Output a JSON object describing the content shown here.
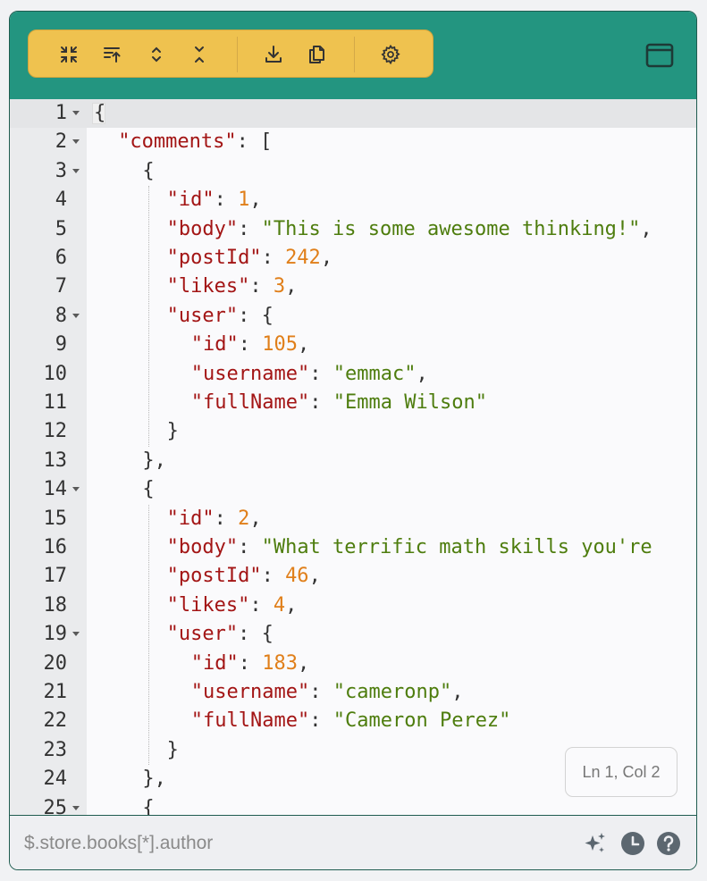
{
  "toolbar": {
    "buttons": [
      {
        "name": "collapse-all-button",
        "icon": "collapse-icon"
      },
      {
        "name": "sort-button",
        "icon": "sort-icon"
      },
      {
        "name": "expand-button",
        "icon": "expand-icon"
      },
      {
        "name": "collapse-button",
        "icon": "collapse-vertical-icon"
      },
      {
        "name": "download-button",
        "icon": "download-icon"
      },
      {
        "name": "copy-button",
        "icon": "copy-icon"
      },
      {
        "name": "settings-button",
        "icon": "gear-icon"
      }
    ],
    "window_button_icon": "window-icon"
  },
  "editor": {
    "active_line": 1,
    "lines": [
      {
        "n": "1",
        "fold": true,
        "indent": 0,
        "tokens": [
          [
            "p",
            "{"
          ]
        ]
      },
      {
        "n": "2",
        "fold": true,
        "indent": 1,
        "tokens": [
          [
            "k",
            "\"comments\""
          ],
          [
            "p",
            ": ["
          ]
        ]
      },
      {
        "n": "3",
        "fold": true,
        "indent": 2,
        "tokens": [
          [
            "p",
            "{"
          ]
        ]
      },
      {
        "n": "4",
        "fold": false,
        "indent": 3,
        "tokens": [
          [
            "k",
            "\"id\""
          ],
          [
            "p",
            ": "
          ],
          [
            "n",
            "1"
          ],
          [
            "p",
            ","
          ]
        ]
      },
      {
        "n": "5",
        "fold": false,
        "indent": 3,
        "tokens": [
          [
            "k",
            "\"body\""
          ],
          [
            "p",
            ": "
          ],
          [
            "s",
            "\"This is some awesome thinking!\""
          ],
          [
            "p",
            ","
          ]
        ]
      },
      {
        "n": "6",
        "fold": false,
        "indent": 3,
        "tokens": [
          [
            "k",
            "\"postId\""
          ],
          [
            "p",
            ": "
          ],
          [
            "n",
            "242"
          ],
          [
            "p",
            ","
          ]
        ]
      },
      {
        "n": "7",
        "fold": false,
        "indent": 3,
        "tokens": [
          [
            "k",
            "\"likes\""
          ],
          [
            "p",
            ": "
          ],
          [
            "n",
            "3"
          ],
          [
            "p",
            ","
          ]
        ]
      },
      {
        "n": "8",
        "fold": true,
        "indent": 3,
        "tokens": [
          [
            "k",
            "\"user\""
          ],
          [
            "p",
            ": {"
          ]
        ]
      },
      {
        "n": "9",
        "fold": false,
        "indent": 4,
        "tokens": [
          [
            "k",
            "\"id\""
          ],
          [
            "p",
            ": "
          ],
          [
            "n",
            "105"
          ],
          [
            "p",
            ","
          ]
        ]
      },
      {
        "n": "10",
        "fold": false,
        "indent": 4,
        "tokens": [
          [
            "k",
            "\"username\""
          ],
          [
            "p",
            ": "
          ],
          [
            "s",
            "\"emmac\""
          ],
          [
            "p",
            ","
          ]
        ]
      },
      {
        "n": "11",
        "fold": false,
        "indent": 4,
        "tokens": [
          [
            "k",
            "\"fullName\""
          ],
          [
            "p",
            ": "
          ],
          [
            "s",
            "\"Emma Wilson\""
          ]
        ]
      },
      {
        "n": "12",
        "fold": false,
        "indent": 3,
        "tokens": [
          [
            "p",
            "}"
          ]
        ]
      },
      {
        "n": "13",
        "fold": false,
        "indent": 2,
        "tokens": [
          [
            "p",
            "},"
          ]
        ]
      },
      {
        "n": "14",
        "fold": true,
        "indent": 2,
        "tokens": [
          [
            "p",
            "{"
          ]
        ]
      },
      {
        "n": "15",
        "fold": false,
        "indent": 3,
        "tokens": [
          [
            "k",
            "\"id\""
          ],
          [
            "p",
            ": "
          ],
          [
            "n",
            "2"
          ],
          [
            "p",
            ","
          ]
        ]
      },
      {
        "n": "16",
        "fold": false,
        "indent": 3,
        "tokens": [
          [
            "k",
            "\"body\""
          ],
          [
            "p",
            ": "
          ],
          [
            "s",
            "\"What terrific math skills you're"
          ]
        ]
      },
      {
        "n": "17",
        "fold": false,
        "indent": 3,
        "tokens": [
          [
            "k",
            "\"postId\""
          ],
          [
            "p",
            ": "
          ],
          [
            "n",
            "46"
          ],
          [
            "p",
            ","
          ]
        ]
      },
      {
        "n": "18",
        "fold": false,
        "indent": 3,
        "tokens": [
          [
            "k",
            "\"likes\""
          ],
          [
            "p",
            ": "
          ],
          [
            "n",
            "4"
          ],
          [
            "p",
            ","
          ]
        ]
      },
      {
        "n": "19",
        "fold": true,
        "indent": 3,
        "tokens": [
          [
            "k",
            "\"user\""
          ],
          [
            "p",
            ": {"
          ]
        ]
      },
      {
        "n": "20",
        "fold": false,
        "indent": 4,
        "tokens": [
          [
            "k",
            "\"id\""
          ],
          [
            "p",
            ": "
          ],
          [
            "n",
            "183"
          ],
          [
            "p",
            ","
          ]
        ]
      },
      {
        "n": "21",
        "fold": false,
        "indent": 4,
        "tokens": [
          [
            "k",
            "\"username\""
          ],
          [
            "p",
            ": "
          ],
          [
            "s",
            "\"cameronp\""
          ],
          [
            "p",
            ","
          ]
        ]
      },
      {
        "n": "22",
        "fold": false,
        "indent": 4,
        "tokens": [
          [
            "k",
            "\"fullName\""
          ],
          [
            "p",
            ": "
          ],
          [
            "s",
            "\"Cameron Perez\""
          ]
        ]
      },
      {
        "n": "23",
        "fold": false,
        "indent": 3,
        "tokens": [
          [
            "p",
            "}"
          ]
        ]
      },
      {
        "n": "24",
        "fold": false,
        "indent": 2,
        "tokens": [
          [
            "p",
            "},"
          ]
        ]
      },
      {
        "n": "25",
        "fold": true,
        "indent": 2,
        "tokens": [
          [
            "p",
            "{"
          ]
        ]
      }
    ]
  },
  "status": {
    "position": "Ln 1, Col 2"
  },
  "query": {
    "placeholder": "$.store.books[*].author",
    "icons": [
      "sparkle-icon",
      "history-icon",
      "help-icon"
    ]
  }
}
